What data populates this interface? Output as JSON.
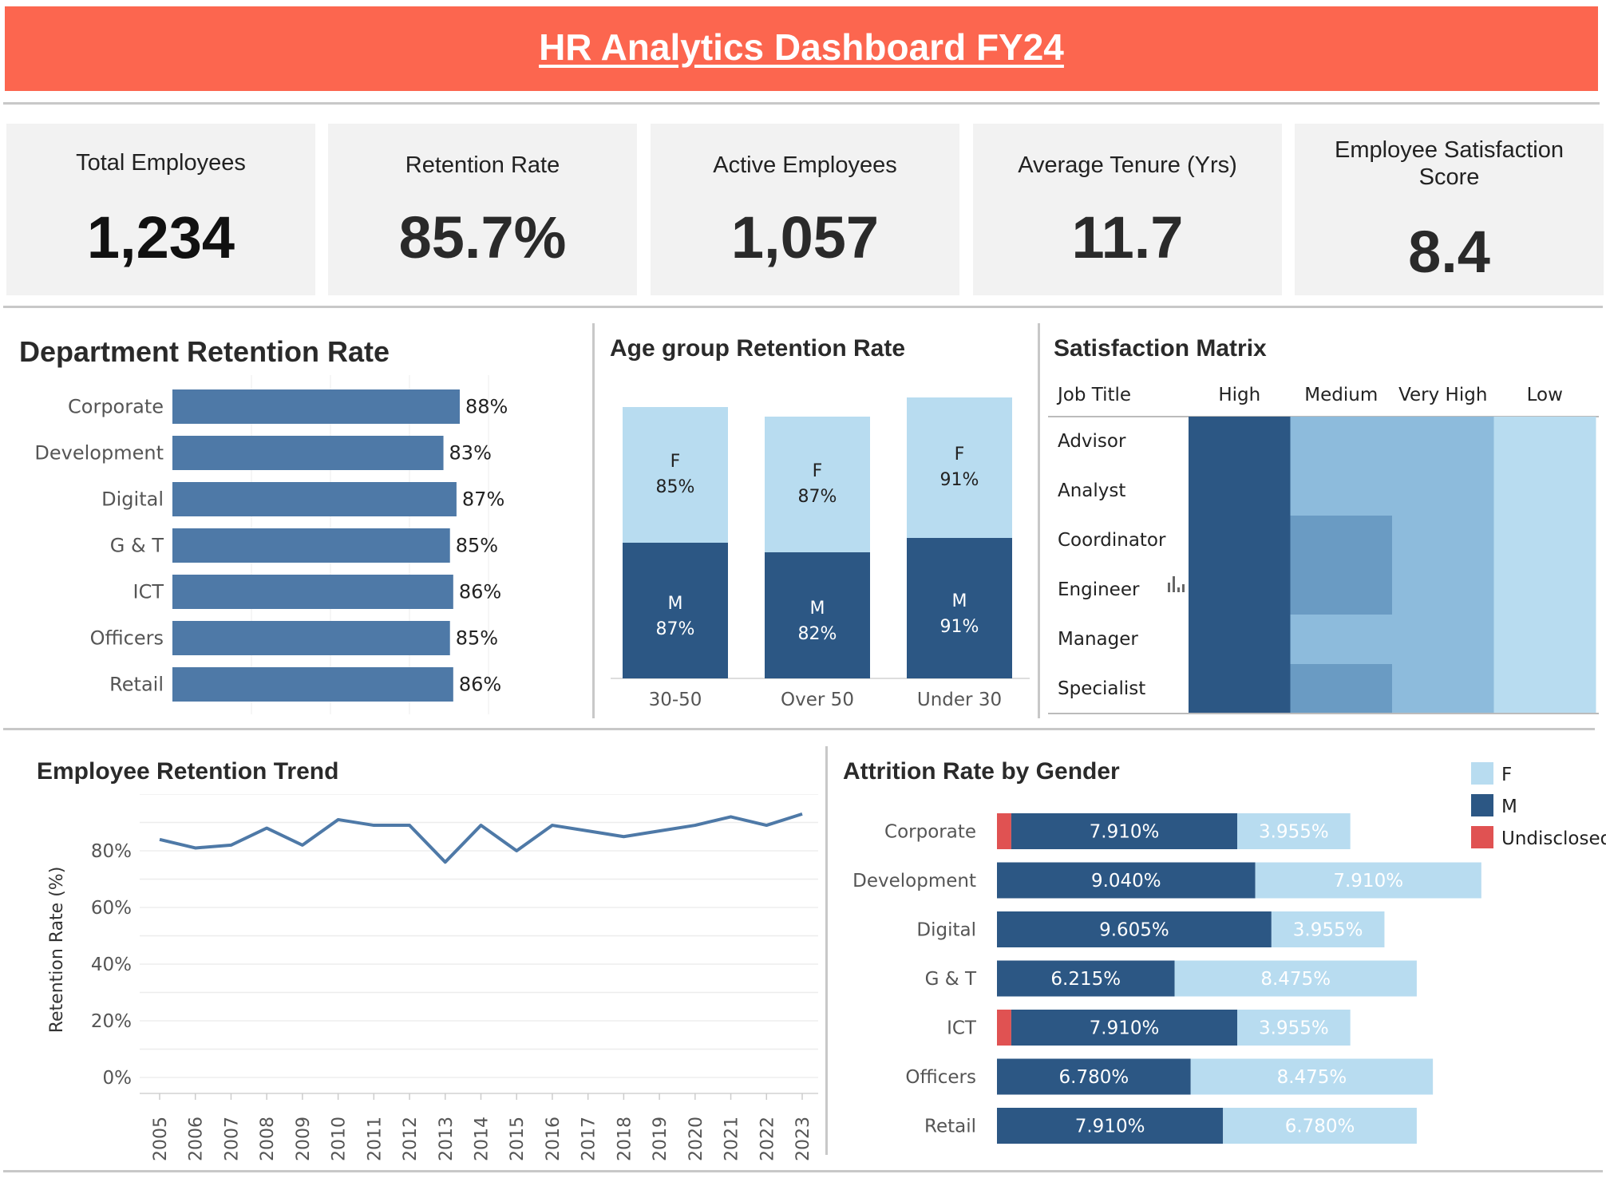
{
  "header": {
    "title": "HR Analytics Dashboard FY24"
  },
  "kpis": [
    {
      "label": "Total Employees",
      "value": "1,234"
    },
    {
      "label": "Retention Rate",
      "value": "85.7%"
    },
    {
      "label": "Active Employees",
      "value": "1,057"
    },
    {
      "label": "Average Tenure (Yrs)",
      "value": "11.7"
    },
    {
      "label": "Employee Satisfaction Score",
      "value": "8.4"
    }
  ],
  "colors": {
    "banner": "#fc664f",
    "primary_bar": "#4e79a7",
    "dark_blue": "#2c5784",
    "light_blue": "#b8dcf0",
    "mid_blue": "#6a9bc3",
    "medium_blue2": "#8dbbdc",
    "red": "#e05252"
  },
  "chart_data": [
    {
      "id": "department_retention",
      "type": "bar",
      "orientation": "horizontal",
      "title": "Department Retention Rate",
      "categories": [
        "Corporate",
        "Development",
        "Digital",
        "G & T",
        "ICT",
        "Officers",
        "Retail"
      ],
      "values": [
        88,
        83,
        87,
        85,
        86,
        85,
        86
      ],
      "labels": [
        "88%",
        "83%",
        "87%",
        "85%",
        "86%",
        "85%",
        "86%"
      ],
      "xlim": [
        0,
        100
      ]
    },
    {
      "id": "age_group_retention",
      "type": "bar",
      "stacked": true,
      "title": "Age group Retention Rate",
      "categories": [
        "30-50",
        "Over 50",
        "Under 30"
      ],
      "series": [
        {
          "name": "M",
          "values": [
            87,
            82,
            91
          ],
          "labels": [
            "87%",
            "82%",
            "91%"
          ]
        },
        {
          "name": "F",
          "values": [
            85,
            87,
            91
          ],
          "labels": [
            "85%",
            "87%",
            "91%"
          ]
        }
      ]
    },
    {
      "id": "satisfaction_matrix",
      "type": "heatmap",
      "title": "Satisfaction Matrix",
      "row_header": "Job Title",
      "columns": [
        "High",
        "Medium",
        "Very High",
        "Low"
      ],
      "rows": [
        "Advisor",
        "Analyst",
        "Coordinator",
        "Engineer",
        "Manager",
        "Specialist"
      ],
      "levels": [
        [
          4,
          2,
          2,
          1
        ],
        [
          4,
          2,
          2,
          1
        ],
        [
          4,
          3,
          2,
          1
        ],
        [
          4,
          3,
          2,
          1
        ],
        [
          4,
          2,
          2,
          1
        ],
        [
          4,
          3,
          2,
          1
        ]
      ]
    },
    {
      "id": "retention_trend",
      "type": "line",
      "title": "Employee Retention Trend",
      "ylabel": "Retention Rate (%)",
      "x": [
        "2005",
        "2006",
        "2007",
        "2008",
        "2009",
        "2010",
        "2011",
        "2012",
        "2013",
        "2014",
        "2015",
        "2016",
        "2017",
        "2018",
        "2019",
        "2020",
        "2021",
        "2022",
        "2023"
      ],
      "values": [
        84,
        81,
        82,
        88,
        82,
        91,
        89,
        89,
        76,
        89,
        80,
        89,
        87,
        85,
        87,
        89,
        92,
        89,
        93
      ],
      "yticks": [
        "0%",
        "20%",
        "40%",
        "60%",
        "80%"
      ],
      "ylim": [
        0,
        100
      ]
    },
    {
      "id": "attrition_by_gender",
      "type": "bar",
      "orientation": "horizontal",
      "stacked": true,
      "title": "Attrition Rate by Gender",
      "categories": [
        "Corporate",
        "Development",
        "Digital",
        "G & T",
        "ICT",
        "Officers",
        "Retail"
      ],
      "legend": [
        "F",
        "M",
        "Undisclosed"
      ],
      "series": [
        {
          "name": "Undisclosed",
          "values": [
            0.5,
            0,
            0,
            0,
            0.5,
            0,
            0
          ]
        },
        {
          "name": "M",
          "values": [
            7.91,
            9.04,
            9.605,
            6.215,
            7.91,
            6.78,
            7.91
          ],
          "labels": [
            "7.910%",
            "9.040%",
            "9.605%",
            "6.215%",
            "7.910%",
            "6.780%",
            "7.910%"
          ]
        },
        {
          "name": "F",
          "values": [
            3.955,
            7.91,
            3.955,
            8.475,
            3.955,
            8.475,
            6.78
          ],
          "labels": [
            "3.955%",
            "7.910%",
            "3.955%",
            "8.475%",
            "3.955%",
            "8.475%",
            "6.780%"
          ]
        }
      ]
    }
  ]
}
